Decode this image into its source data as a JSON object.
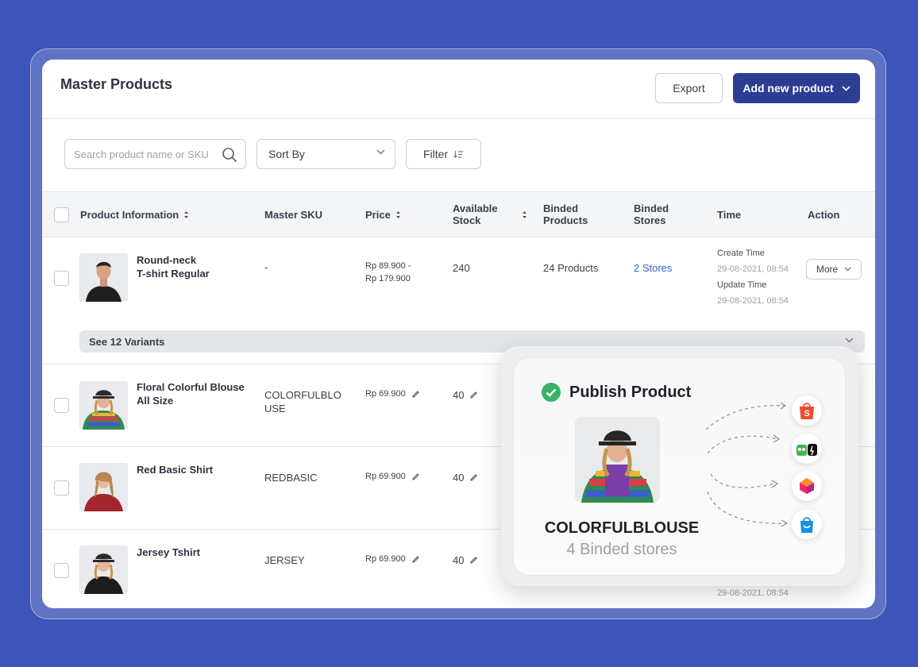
{
  "header": {
    "title": "Master Products",
    "export_label": "Export",
    "add_label": "Add new product"
  },
  "toolbar": {
    "search_placeholder": "Search product name or SKU",
    "sort_label": "Sort By",
    "filter_label": "Filter"
  },
  "table": {
    "columns": {
      "product": "Product Information",
      "sku": "Master SKU",
      "price": "Price",
      "stock_1": "Available",
      "stock_2": "Stock",
      "binded_products_1": "Binded",
      "binded_products_2": "Products",
      "binded_stores_1": "Binded",
      "binded_stores_2": "Stores",
      "time": "Time",
      "action": "Action"
    },
    "rows": [
      {
        "name_1": "Round-neck",
        "name_2": "T-shirt Regular",
        "sku": "-",
        "price_1": "Rp 89.900 -",
        "price_2": "Rp 179.900",
        "stock": "240",
        "binded_products": "24 Products",
        "binded_stores": "2 Stores",
        "create_label": "Create Time",
        "create_value": "29-08-2021, 08:54",
        "update_label": "Update Time",
        "update_value": "29-08-2021, 08:54",
        "action": "More",
        "variants": "See 12 Variants"
      },
      {
        "name_1": "Floral Colorful Blouse",
        "name_2": "All Size",
        "sku_1": "COLORFULBLO",
        "sku_2": "USE",
        "price": "Rp 69.900",
        "stock": "40"
      },
      {
        "name_1": "Red Basic Shirt",
        "sku": "REDBASIC",
        "price": "Rp 69.900",
        "stock": "40"
      },
      {
        "name_1": "Jersey Tshirt",
        "sku": "JERSEY",
        "price": "Rp 69.900",
        "stock": "40",
        "update_value": "29-08-2021, 08:54"
      }
    ]
  },
  "popup": {
    "title": "Publish Product",
    "sku": "COLORFULBLOUSE",
    "stores": "4 Binded stores",
    "store_icons": [
      "shopee-icon",
      "tokopedia-icon",
      "lazada-icon",
      "blibli-icon"
    ]
  },
  "colors": {
    "background": "#3d54b8",
    "primary": "#2c3e94",
    "link": "#3c62c6",
    "success": "#3ab26a"
  }
}
